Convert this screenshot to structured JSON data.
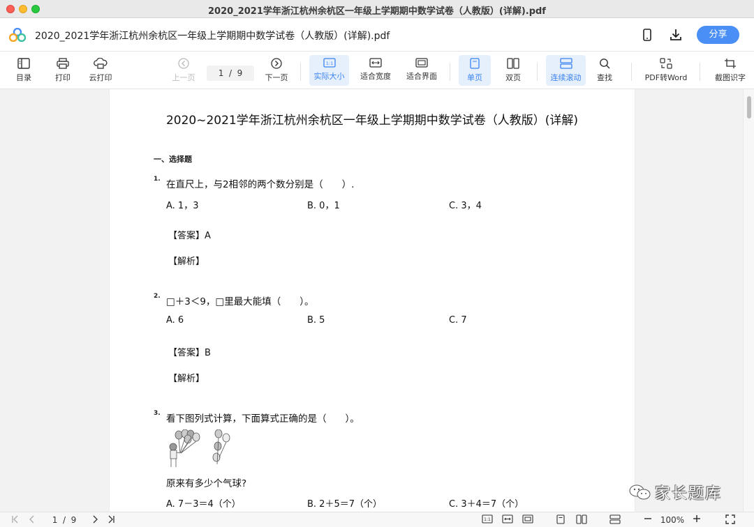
{
  "window": {
    "title": "2020_2021学年浙江杭州余杭区一年级上学期期中数学试卷（人教版）(详解).pdf"
  },
  "header": {
    "doc_name": "2020_2021学年浙江杭州余杭区一年级上学期期中数学试卷（人教版）(详解).pdf",
    "share_label": "分享"
  },
  "toolbar": {
    "toc": "目录",
    "print": "打印",
    "cloud_print": "云打印",
    "prev_page": "上一页",
    "page_current": "1",
    "page_sep": "/",
    "page_total": "9",
    "next_page": "下一页",
    "actual_size": "实际大小",
    "fit_width": "适合宽度",
    "fit_screen": "适合界面",
    "single_page": "单页",
    "double_page": "双页",
    "continuous": "连续滚动",
    "find": "查找",
    "pdf_to_word": "PDF转Word",
    "ocr": "截图识字",
    "actual_size_icon_text": "1:1"
  },
  "doc": {
    "title": "2020~2021学年浙江杭州余杭区一年级上学期期中数学试卷（人教版）(详解)",
    "section": "一、选择题",
    "questions": [
      {
        "num": "1.",
        "text": "在直尺上，与2相邻的两个数分别是（　　）.",
        "options": [
          "A. 1，3",
          "B. 0，1",
          "C. 3，4"
        ],
        "answer": "【答案】A",
        "analysis": "【解析】"
      },
      {
        "num": "2.",
        "text": "□＋3＜9，□里最大能填（　　）。",
        "options": [
          "A. 6",
          "B. 5",
          "C. 7"
        ],
        "answer": "【答案】B",
        "analysis": "【解析】"
      },
      {
        "num": "3.",
        "text": "看下图列式计算，下面算式正确的是（　　）。",
        "sub": "原来有多少个气球?",
        "options": [
          "A. 7－3＝4（个）",
          "B. 2＋5＝7（个）",
          "C. 3＋4＝7（个）"
        ]
      }
    ]
  },
  "watermark": "家长题库",
  "status": {
    "page_current": "1",
    "page_sep": "/",
    "page_total": "9",
    "zoom": "100%",
    "actual_size_icon_text": "1:1"
  },
  "colors": {
    "accent": "#4a8ff5",
    "active_bg": "#e6f0fd"
  }
}
